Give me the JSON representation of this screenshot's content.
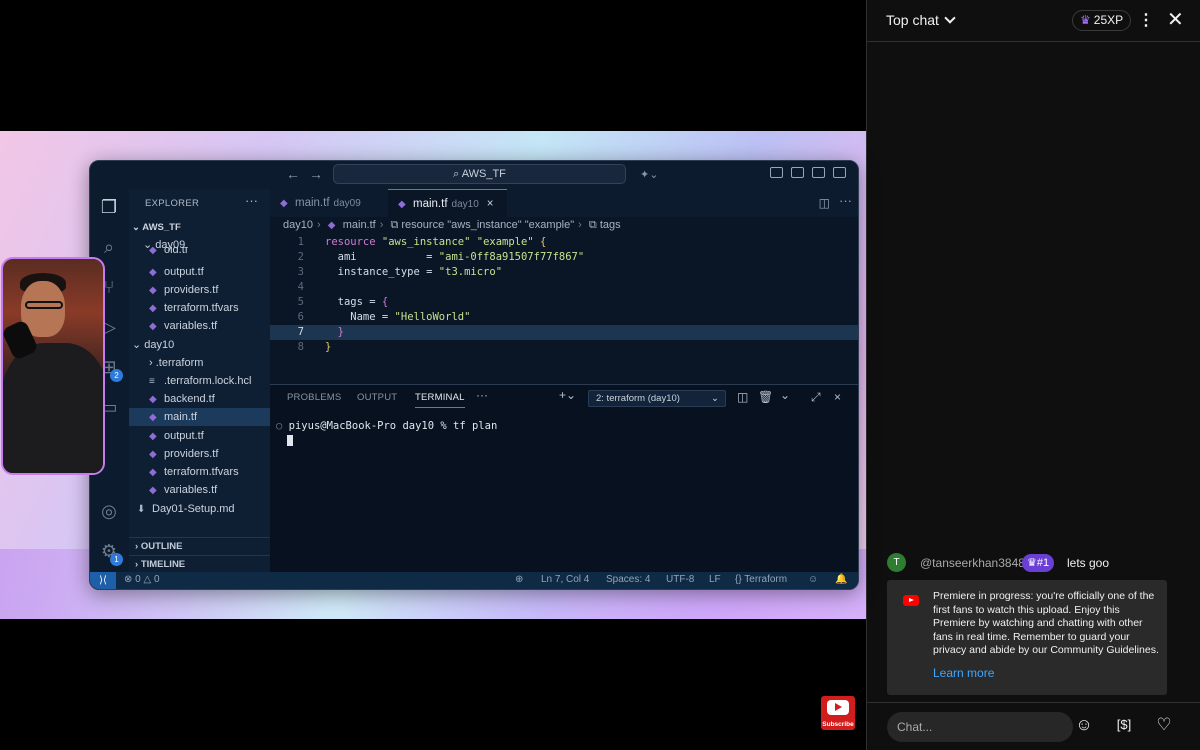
{
  "vscode": {
    "command_center": "AWS_TF",
    "explorer_title": "EXPLORER",
    "root_folder": "AWS_TF",
    "tree": [
      {
        "label": "day09",
        "type": "folder"
      },
      {
        "label": "old.tf",
        "type": "file"
      },
      {
        "label": "output.tf",
        "type": "file"
      },
      {
        "label": "providers.tf",
        "type": "file"
      },
      {
        "label": "terraform.tfvars",
        "type": "file"
      },
      {
        "label": "variables.tf",
        "type": "file"
      },
      {
        "label": "day10",
        "type": "folder"
      },
      {
        "label": ".terraform",
        "type": "folder"
      },
      {
        "label": ".terraform.lock.hcl",
        "type": "file"
      },
      {
        "label": "backend.tf",
        "type": "file"
      },
      {
        "label": "main.tf",
        "type": "file",
        "selected": true
      },
      {
        "label": "output.tf",
        "type": "file"
      },
      {
        "label": "providers.tf",
        "type": "file"
      },
      {
        "label": "terraform.tfvars",
        "type": "file"
      },
      {
        "label": "variables.tf",
        "type": "file"
      },
      {
        "label": "Day01-Setup.md",
        "type": "file"
      }
    ],
    "outline_label": "OUTLINE",
    "timeline_label": "TIMELINE",
    "tabs": [
      {
        "label": "main.tf",
        "sub": "day09",
        "active": false
      },
      {
        "label": "main.tf",
        "sub": "day10",
        "active": true
      }
    ],
    "breadcrumb": [
      "day10",
      "main.tf",
      "resource \"aws_instance\" \"example\"",
      "tags"
    ],
    "code_lines": [
      "resource \"aws_instance\" \"example\" {",
      "  ami           = \"ami-0ff8a91507f77f867\"",
      "  instance_type = \"t3.micro\"",
      "",
      "  tags = {",
      "    Name = \"HelloWorld\"",
      "  }",
      "}"
    ],
    "line_numbers": [
      "1",
      "2",
      "3",
      "4",
      "5",
      "6",
      "7",
      "8"
    ],
    "panel_tabs": [
      "PROBLEMS",
      "OUTPUT",
      "TERMINAL"
    ],
    "terminal_select": "2: terraform (day10)",
    "terminal_prompt": "piyus@MacBook-Pro day10 % tf plan",
    "status": {
      "errors": "0",
      "warnings": "0",
      "position": "Ln 7, Col 4",
      "spaces": "Spaces: 4",
      "encoding": "UTF-8",
      "eol": "LF",
      "language": "Terraform"
    },
    "badges": {
      "scm": "2",
      "settings": "1"
    }
  },
  "subscribe_label": "Subscribe",
  "chat": {
    "title": "Top chat",
    "xp": "25XP",
    "message": {
      "avatar_letter": "T",
      "author": "@tanseerkhan3848",
      "rank": "#1",
      "text": "lets goo"
    },
    "notice": {
      "text": "Premiere in progress: you're officially one of the first fans to watch this upload. Enjoy this Premiere by watching and chatting with other fans in real time. Remember to guard your privacy and abide by our Community Guidelines.",
      "link": "Learn more"
    },
    "input_placeholder": "Chat...",
    "colors": {
      "background": "#0f0f0f",
      "link": "#3ea6ff",
      "rank_badge": "#6b3fd6"
    }
  }
}
